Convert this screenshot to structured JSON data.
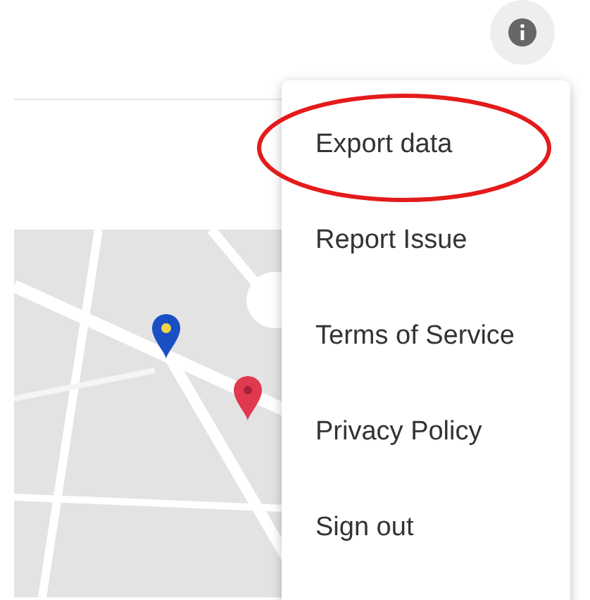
{
  "menu": {
    "items": [
      {
        "label": "Export data",
        "highlighted": true
      },
      {
        "label": "Report Issue",
        "highlighted": false
      },
      {
        "label": "Terms of Service",
        "highlighted": false
      },
      {
        "label": "Privacy Policy",
        "highlighted": false
      },
      {
        "label": "Sign out",
        "highlighted": false
      }
    ]
  }
}
